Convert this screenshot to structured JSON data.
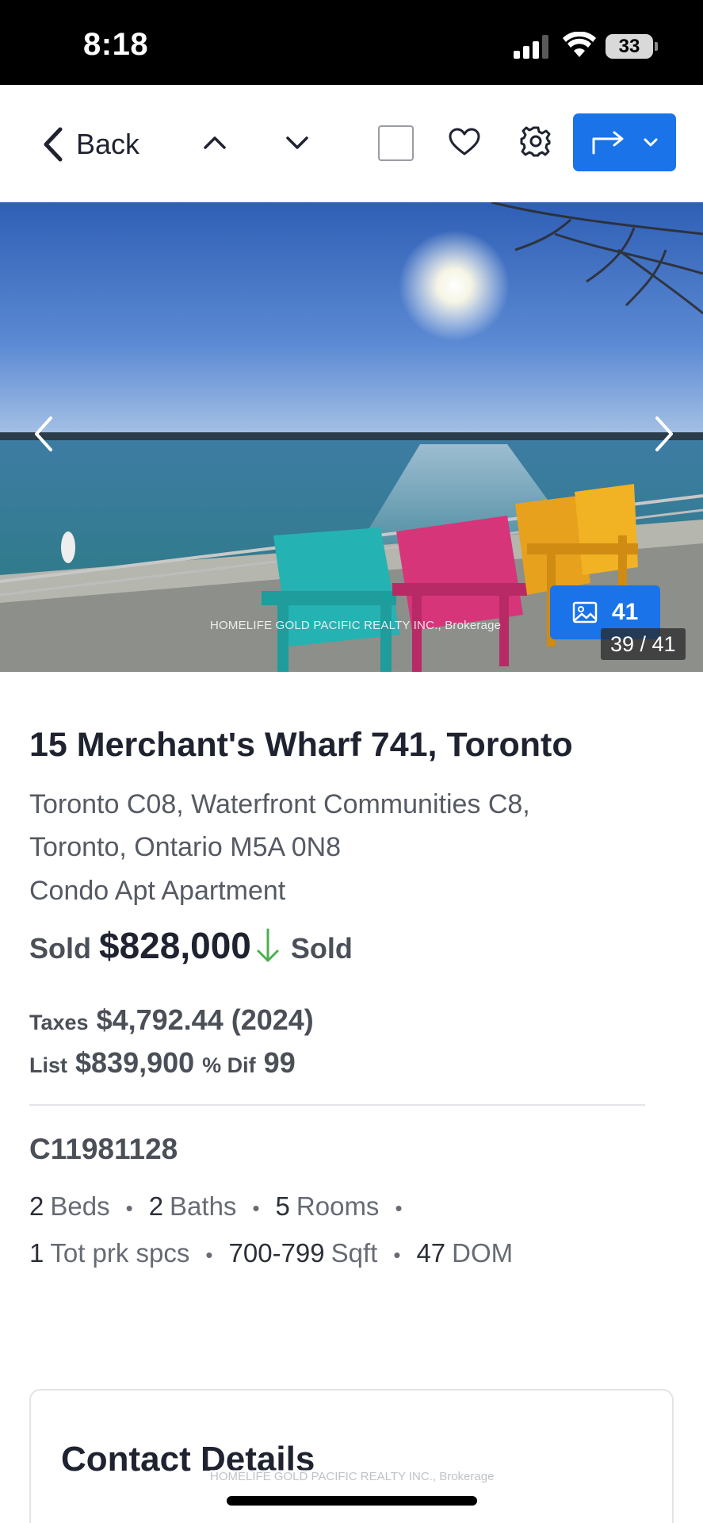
{
  "status_bar": {
    "time": "8:18",
    "battery": "33"
  },
  "toolbar": {
    "back_label": "Back",
    "icons": [
      "chevron-left-icon",
      "chevron-up-icon",
      "chevron-down-icon",
      "checkbox",
      "heart-icon",
      "gear-icon",
      "share-icon",
      "dropdown-icon"
    ],
    "accent_color": "#1a73e8"
  },
  "photo": {
    "watermark": "HOMELIFE GOLD PACIFIC REALTY INC., Brokerage",
    "photo_count": "41",
    "index_label": "39 / 41"
  },
  "listing": {
    "title": "15 Merchant's Wharf 741, Toronto",
    "address_line1": "Toronto C08, Waterfront Communities C8,",
    "address_line2": "Toronto, Ontario M5A 0N8",
    "property_type": "Condo Apt Apartment",
    "sold_label": "Sold",
    "sold_price": "$828,000",
    "status": "Sold",
    "status_arrow_color": "#4caf50",
    "taxes_label": "Taxes",
    "taxes_value": "$4,792.44 (2024)",
    "list_label": "List",
    "list_price": "$839,900",
    "dif_label": "% Dif",
    "dif_value": "99",
    "mls_number": "C11981128"
  },
  "facts_row1": [
    {
      "num": "2",
      "unit": "Beds"
    },
    {
      "num": "2",
      "unit": "Baths"
    },
    {
      "num": "5",
      "unit": "Rooms"
    }
  ],
  "facts_row2": [
    {
      "num": "1",
      "unit": "Tot prk spcs"
    },
    {
      "num": "700-799",
      "unit": "Sqft"
    },
    {
      "num": "47",
      "unit": "DOM"
    }
  ],
  "contact": {
    "title": "Contact Details",
    "watermark": "HOMELIFE GOLD PACIFIC REALTY INC., Brokerage"
  }
}
